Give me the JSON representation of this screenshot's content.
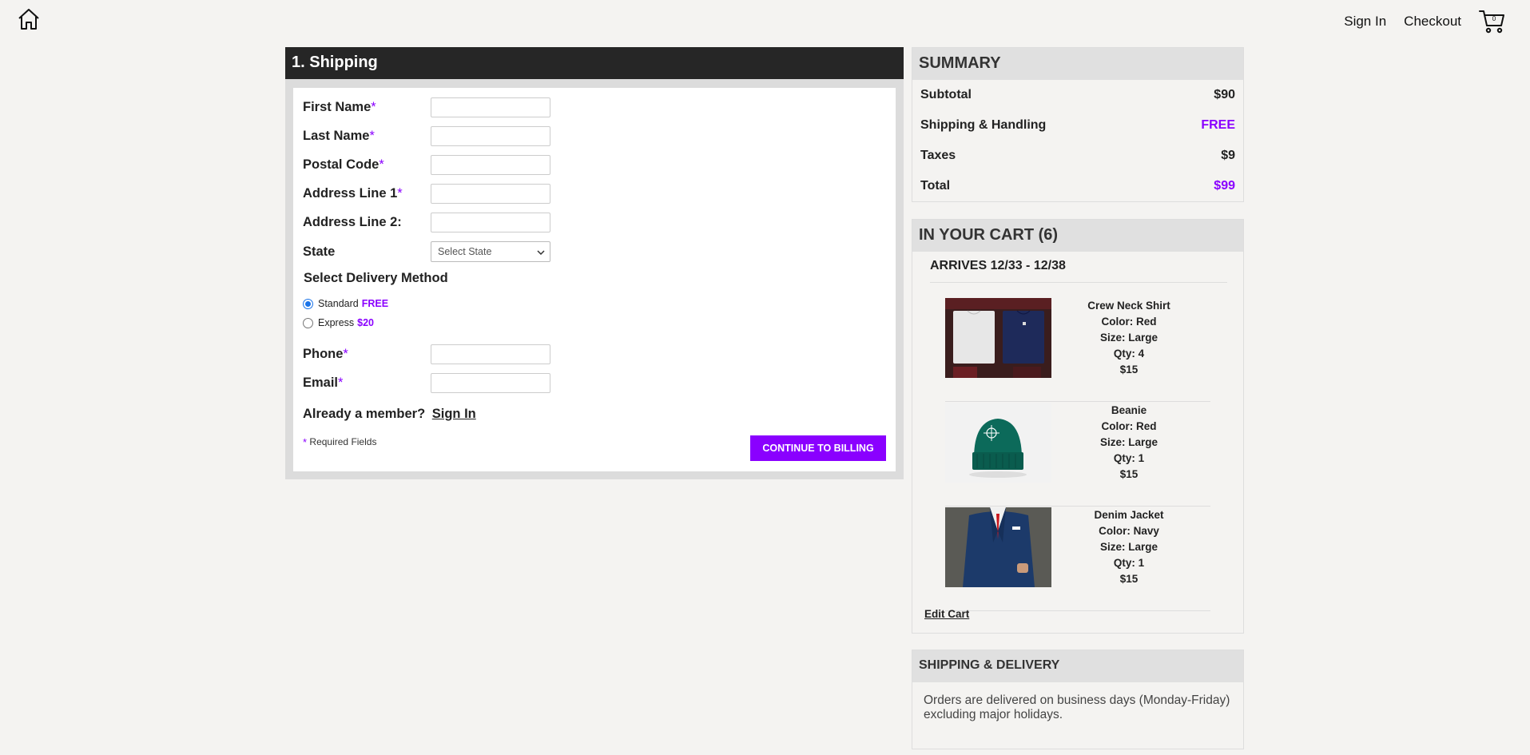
{
  "nav": {
    "sign_in": "Sign In",
    "checkout": "Checkout",
    "cart_count": "0"
  },
  "shipping": {
    "title": "1. Shipping",
    "fields": {
      "first_name": "First Name",
      "last_name": "Last Name",
      "postal_code": "Postal Code",
      "address1": "Address Line 1",
      "address2": "Address Line 2:",
      "state": "State",
      "phone": "Phone",
      "email": "Email"
    },
    "required_mark": "*",
    "state_placeholder": "Select State",
    "delivery_title": "Select Delivery Method",
    "delivery_options": [
      {
        "label": "Standard",
        "price": "FREE",
        "selected": true
      },
      {
        "label": "Express",
        "price": "$20",
        "selected": false
      }
    ],
    "member_text": "Already a member?",
    "member_link": "Sign In",
    "required_note": "Required Fields",
    "continue_label": "CONTINUE TO BILLING"
  },
  "summary": {
    "title": "SUMMARY",
    "rows": [
      {
        "label": "Subtotal",
        "value": "$90"
      },
      {
        "label": "Shipping & Handling",
        "value": "FREE"
      },
      {
        "label": "Taxes",
        "value": "$9"
      },
      {
        "label": "Total",
        "value": "$99"
      }
    ]
  },
  "cart": {
    "title": "IN YOUR CART (6)",
    "arrives": "ARRIVES 12/33 - 12/38",
    "items": [
      {
        "name": "Crew Neck Shirt",
        "color": "Color: Red",
        "size": "Size: Large",
        "qty": "Qty: 4",
        "price": "$15"
      },
      {
        "name": "Beanie",
        "color": "Color: Red",
        "size": "Size: Large",
        "qty": "Qty: 1",
        "price": "$15"
      },
      {
        "name": "Denim Jacket",
        "color": "Color: Navy",
        "size": "Size: Large",
        "qty": "Qty: 1",
        "price": "$15"
      }
    ],
    "edit_label": "Edit Cart"
  },
  "delivery_info": {
    "title": "SHIPPING & DELIVERY",
    "text": "Orders are delivered on business days (Monday-Friday) excluding major holidays."
  },
  "colors": {
    "accent": "#8a00ff",
    "header_dark": "#262626"
  }
}
